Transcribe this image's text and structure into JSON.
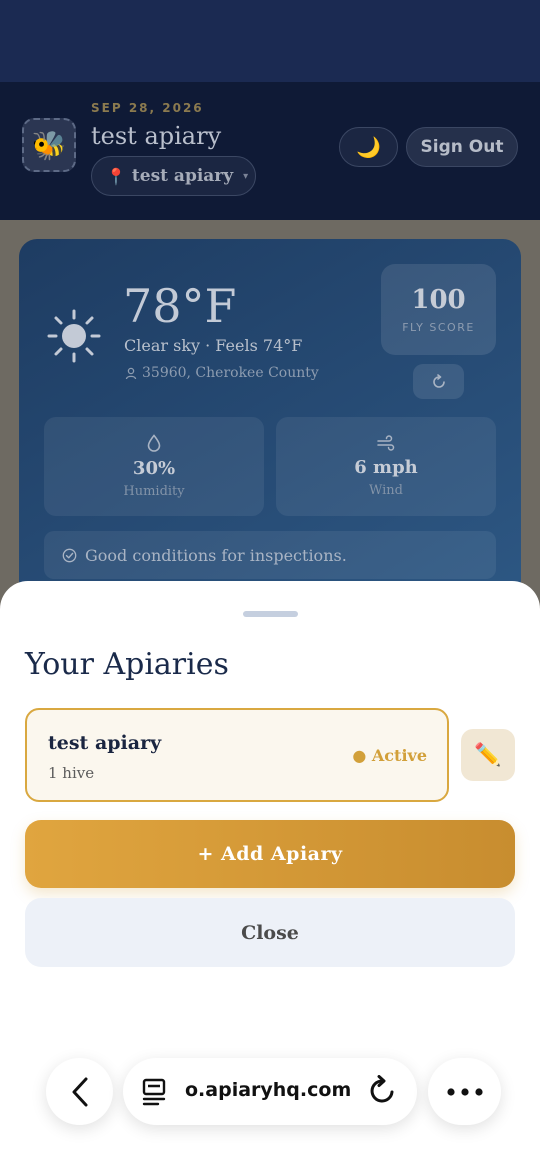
{
  "header": {
    "date": "SEP 28, 2026",
    "title": "test apiary",
    "avatar_emoji": "🐝",
    "apiary_selector": {
      "icon": "pin-icon",
      "label": "test apiary",
      "chevron": "▾"
    },
    "theme_toggle_icon": "🌙",
    "sign_out_label": "Sign Out"
  },
  "weather": {
    "icon": "sun-icon",
    "temperature": "78°F",
    "conditions": "Clear sky · Feels 74°F",
    "location": "35960, Cherokee County",
    "fly_score": "100",
    "fly_score_label": "FLY SCORE",
    "humidity": {
      "value": "30%",
      "label": "Humidity"
    },
    "wind": {
      "value": "6 mph",
      "label": "Wind"
    },
    "note": "Good conditions for inspections."
  },
  "sheet": {
    "title": "Your Apiaries",
    "apiaries": [
      {
        "name": "test apiary",
        "hives": "1 hive",
        "status": "● Active"
      }
    ],
    "edit_icon": "✏️",
    "add_label": "+ Add Apiary",
    "close_label": "Close"
  },
  "browser": {
    "url": "o.apiaryhq.com"
  },
  "colors": {
    "accent": "#d9a840",
    "header_bg": "#0f1a36",
    "card_bg": "#2d5783"
  }
}
